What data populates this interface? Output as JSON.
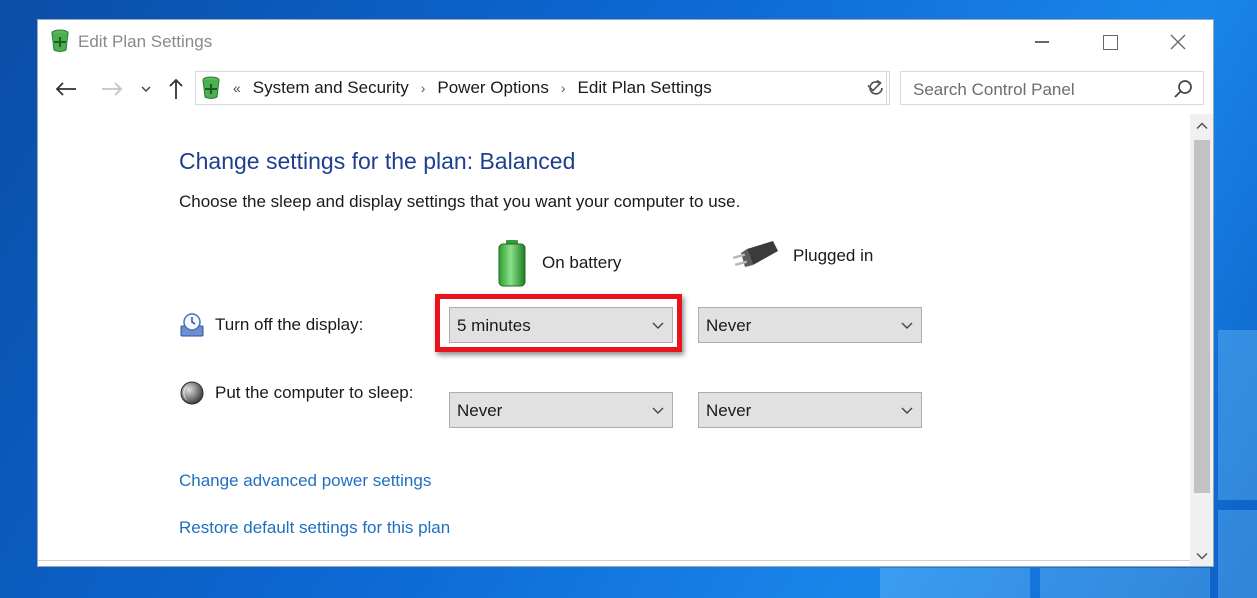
{
  "window": {
    "title": "Edit Plan Settings",
    "icon": "power-plan-icon",
    "controls": [
      "minimize",
      "maximize",
      "close"
    ]
  },
  "navigation": {
    "back": "back-arrow-icon",
    "forward": "forward-arrow-icon",
    "recent": "chevron-down-icon",
    "up": "up-arrow-icon",
    "breadcrumb_prefix": "«",
    "breadcrumbs": [
      "System and Security",
      "Power Options",
      "Edit Plan Settings"
    ],
    "search_placeholder": "Search Control Panel"
  },
  "main": {
    "heading": "Change settings for the plan: Balanced",
    "subtext": "Choose the sleep and display settings that you want your computer to use.",
    "columns": {
      "battery": "On battery",
      "plugged": "Plugged in"
    },
    "rows": [
      {
        "label": "Turn off the display:",
        "icon": "monitor-clock-icon",
        "battery": "5 minutes",
        "plugged": "Never"
      },
      {
        "label": "Put the computer to sleep:",
        "icon": "moon-sleep-icon",
        "battery": "Never",
        "plugged": "Never"
      }
    ],
    "links": {
      "advanced": "Change advanced power settings",
      "restore": "Restore default settings for this plan"
    }
  },
  "colors": {
    "heading": "#1e3f8f",
    "link": "#1f6fc0",
    "highlight": "#e8141c"
  }
}
